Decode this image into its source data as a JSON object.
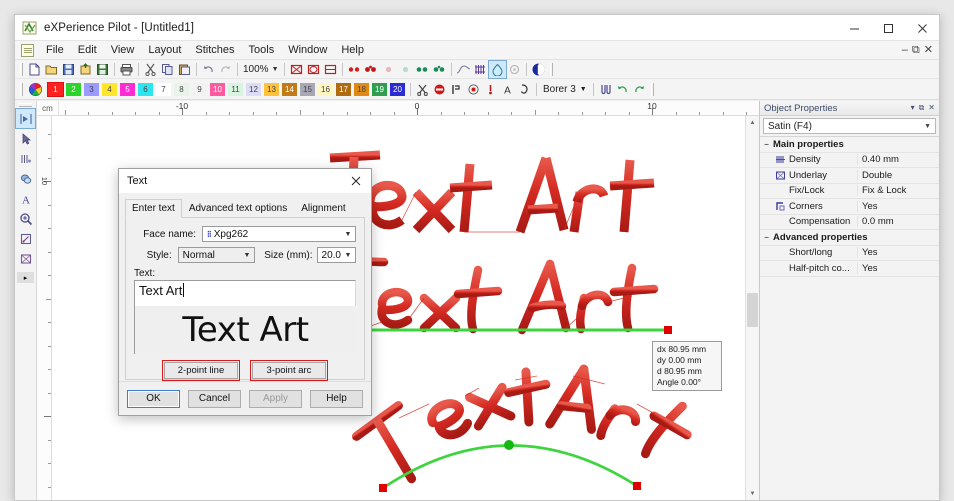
{
  "window": {
    "title": "eXPerience Pilot - [Untitled1]",
    "app_icon": "embroidery-app-icon",
    "minimize": "–",
    "maximize": "☐",
    "close": "✕"
  },
  "menubar": {
    "items": [
      "File",
      "Edit",
      "View",
      "Layout",
      "Stitches",
      "Tools",
      "Window",
      "Help"
    ],
    "doc_controls": [
      "–",
      "⧉",
      "✕"
    ]
  },
  "toolbar_main": {
    "zoom_value": "100%",
    "buttons": [
      "new-icon",
      "open-icon",
      "save-icon",
      "export-icon",
      "save-as-icon",
      "print-icon",
      "cut-icon",
      "copy-icon",
      "paste-icon",
      "undo-icon",
      "redo-icon"
    ],
    "stitch_buttons": [
      "hoop-1-icon",
      "hoop-2-icon",
      "hoop-3-icon",
      "stitch-dense-a-icon",
      "stitch-dense-b-icon",
      "stitch-light-a-icon",
      "stitch-light-b-icon",
      "stitch-green-a-icon",
      "stitch-green-b-icon",
      "curve-icon",
      "column-icon",
      "fill-shape-icon",
      "circle-outline-icon",
      "contrast-icon"
    ]
  },
  "toolbar_colors": {
    "wheel_icon": "color-wheel-icon",
    "swatches": [
      {
        "n": "1",
        "color": "#ff2020",
        "active": true
      },
      {
        "n": "2",
        "color": "#2bd42b",
        "active": false
      },
      {
        "n": "3",
        "color": "#9a9aff",
        "active": false
      },
      {
        "n": "4",
        "color": "#ffe62b",
        "active": false
      },
      {
        "n": "5",
        "color": "#ff2bd4",
        "active": false
      },
      {
        "n": "6",
        "color": "#2be6f0",
        "active": false
      },
      {
        "n": "7",
        "color": "#ffffff",
        "active": false
      },
      {
        "n": "8",
        "color": "#eaf3ea",
        "active": false
      },
      {
        "n": "9",
        "color": "#f2f2f2",
        "active": false
      },
      {
        "n": "10",
        "color": "#ff5aa0",
        "active": false
      },
      {
        "n": "11",
        "color": "#d9f5e2",
        "active": false
      },
      {
        "n": "12",
        "color": "#dcdcf7",
        "active": false
      },
      {
        "n": "13",
        "color": "#ffc23a",
        "active": false
      },
      {
        "n": "14",
        "color": "#c07a16",
        "active": false
      },
      {
        "n": "15",
        "color": "#a8a8b4",
        "active": false
      },
      {
        "n": "16",
        "color": "#fff6c2",
        "active": false
      },
      {
        "n": "17",
        "color": "#b06a10",
        "active": false
      },
      {
        "n": "18",
        "color": "#e08a16",
        "active": false
      },
      {
        "n": "19",
        "color": "#2f9e52",
        "active": false
      },
      {
        "n": "20",
        "color": "#2b2bd4",
        "active": false
      }
    ],
    "needle_label": "Borer 3",
    "tool_icons": [
      "scissors-icon",
      "stop-icon",
      "trim-icon",
      "needle-target-icon",
      "needle-icon",
      "letter-a-icon",
      "hook-icon"
    ],
    "right_icons": [
      "align-icon",
      "undo-green-icon",
      "redo-green-icon"
    ]
  },
  "left_toolbar": {
    "items": [
      "select-object-icon",
      "node-edit-icon",
      "stitch-edit-icon",
      "reshape-icon",
      "text-tool-icon",
      "zoom-tool-icon",
      "measure-icon",
      "hoop-tool-icon"
    ],
    "more": "▸"
  },
  "rulers": {
    "unit": "cm",
    "h_labels": [
      "-10",
      "0",
      "10"
    ],
    "v_labels": [
      "10"
    ]
  },
  "dialog": {
    "title": "Text",
    "close": "✕",
    "tabs": [
      {
        "label": "Enter text",
        "active": true
      },
      {
        "label": "Advanced text options",
        "active": false
      },
      {
        "label": "Alignment",
        "active": false
      }
    ],
    "face_name_label": "Face name:",
    "face_name_value": "Xpg262",
    "face_name_glyph": "⦀",
    "style_label": "Style:",
    "style_value": "Normal",
    "size_label": "Size (mm):",
    "size_value": "20.0",
    "text_label": "Text:",
    "text_value": "Text Art",
    "preview_text": "Text Art",
    "buttons": {
      "two_point_line": "2-point line",
      "three_point_arc": "3-point arc",
      "ok": "OK",
      "cancel": "Cancel",
      "apply": "Apply",
      "help": "Help"
    }
  },
  "canvas": {
    "art_items": [
      {
        "text": "Text Art",
        "name": "text-art-straight"
      },
      {
        "text": "Text Art",
        "name": "text-art-baseline"
      },
      {
        "text": "Text Art",
        "name": "text-art-arc"
      }
    ],
    "info_box": {
      "dx": "dx 80.95 mm",
      "dy": "dy 0.00 mm",
      "d": "d 80.95 mm",
      "angle": "Angle 0.00°"
    },
    "colors": {
      "thread": "#d42a22",
      "guide": "#3dd43d",
      "handle": "#e00000",
      "center_handle": "#14b814"
    }
  },
  "object_properties": {
    "panel_title": "Object Properties",
    "panel_controls": [
      "▾",
      "⧉",
      "✕"
    ],
    "type_value": "Satin (F4)",
    "groups": [
      {
        "name": "Main properties",
        "expander": "−",
        "rows": [
          {
            "icon": "density-icon",
            "name": "Density",
            "value": "0.40 mm"
          },
          {
            "icon": "underlay-icon",
            "name": "Underlay",
            "value": "Double"
          },
          {
            "icon": "",
            "name": "Fix/Lock",
            "value": "Fix & Lock"
          },
          {
            "icon": "corners-icon",
            "name": "Corners",
            "value": "Yes"
          },
          {
            "icon": "",
            "name": "Compensation",
            "value": "0.0 mm"
          }
        ]
      },
      {
        "name": "Advanced properties",
        "expander": "−",
        "rows": [
          {
            "icon": "",
            "name": "Short/long",
            "value": "Yes"
          },
          {
            "icon": "",
            "name": "Half-pitch co...",
            "value": "Yes"
          }
        ]
      }
    ]
  }
}
